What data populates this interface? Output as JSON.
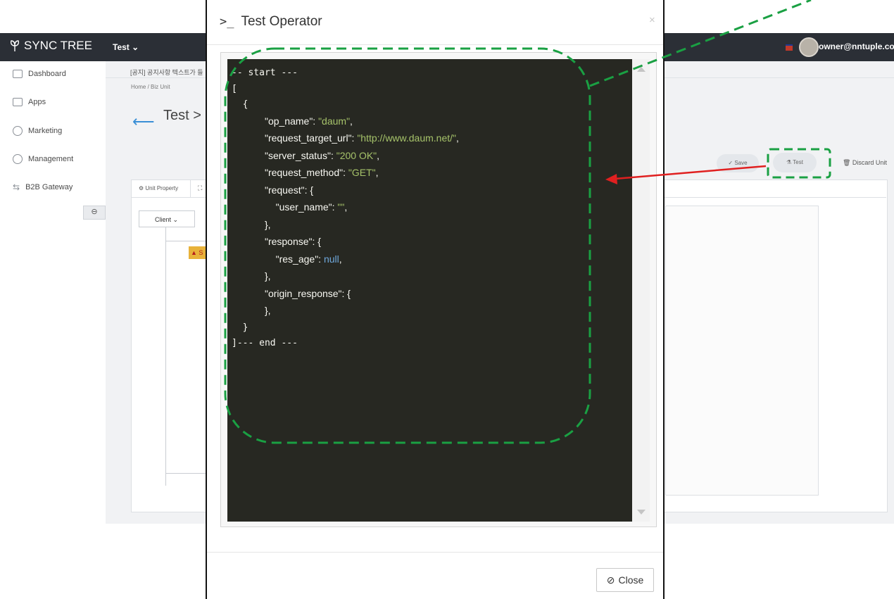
{
  "app": {
    "brand": "SYNC TREE",
    "app_switcher": "Test ⌄",
    "user_email": "owner@nntuple.com"
  },
  "sidebar": {
    "items": [
      {
        "label": "Dashboard",
        "icon": "dashboard-icon"
      },
      {
        "label": "Apps",
        "icon": "apps-icon"
      },
      {
        "label": "Marketing",
        "icon": "marketing-icon"
      },
      {
        "label": "Management",
        "icon": "management-icon"
      },
      {
        "label": "B2B Gateway",
        "icon": "gateway-icon"
      }
    ],
    "collapse_glyph": "⊖"
  },
  "main": {
    "notice": "[공지] 공지사항 텍스트가 들",
    "breadcrumb": "Home  /  Biz Unit",
    "title": "Test >",
    "buttons": {
      "save": "✓ Save",
      "test": "⚗ Test",
      "discard": "🗑 Discard Unit"
    },
    "tabs": {
      "unit_property": "⚙ Unit Property",
      "flow_icon": "⛶"
    },
    "client_select": "Client  ⌄",
    "warn_chip": "▲ S"
  },
  "modal": {
    "title_icon": ">_",
    "title": "Test Operator",
    "close_x": "×",
    "close_label": "Close",
    "close_icon": "⊘",
    "code": {
      "start": "-- start ---",
      "open_bracket": "[",
      "open_brace": "  {",
      "fields": [
        {
          "key": "\"op_name\"",
          "value": "\"daum\"",
          "kind": "s",
          "tail": ","
        },
        {
          "key": "\"request_target_url\"",
          "value": "\"http://www.daum.net/\"",
          "kind": "s",
          "tail": ","
        },
        {
          "key": "\"server_status\"",
          "value": "\"200 OK\"",
          "kind": "s",
          "tail": ","
        },
        {
          "key": "\"request_method\"",
          "value": "\"GET\"",
          "kind": "s",
          "tail": ","
        }
      ],
      "request_key": "\"request\"",
      "user_name_key": "\"user_name\"",
      "user_name_value": "\"\"",
      "response_key": "\"response\"",
      "res_age_key": "\"res_age\"",
      "res_age_value": "null",
      "origin_response_key": "\"origin_response\"",
      "close_brace": "  }",
      "end": "]--- end ---"
    }
  },
  "colors": {
    "topbar": "#2b2f36",
    "code_bg": "#272822",
    "string": "#a6c36a",
    "null": "#6fa8dc",
    "annotation_green": "#1aa043",
    "annotation_red": "#e02020"
  }
}
